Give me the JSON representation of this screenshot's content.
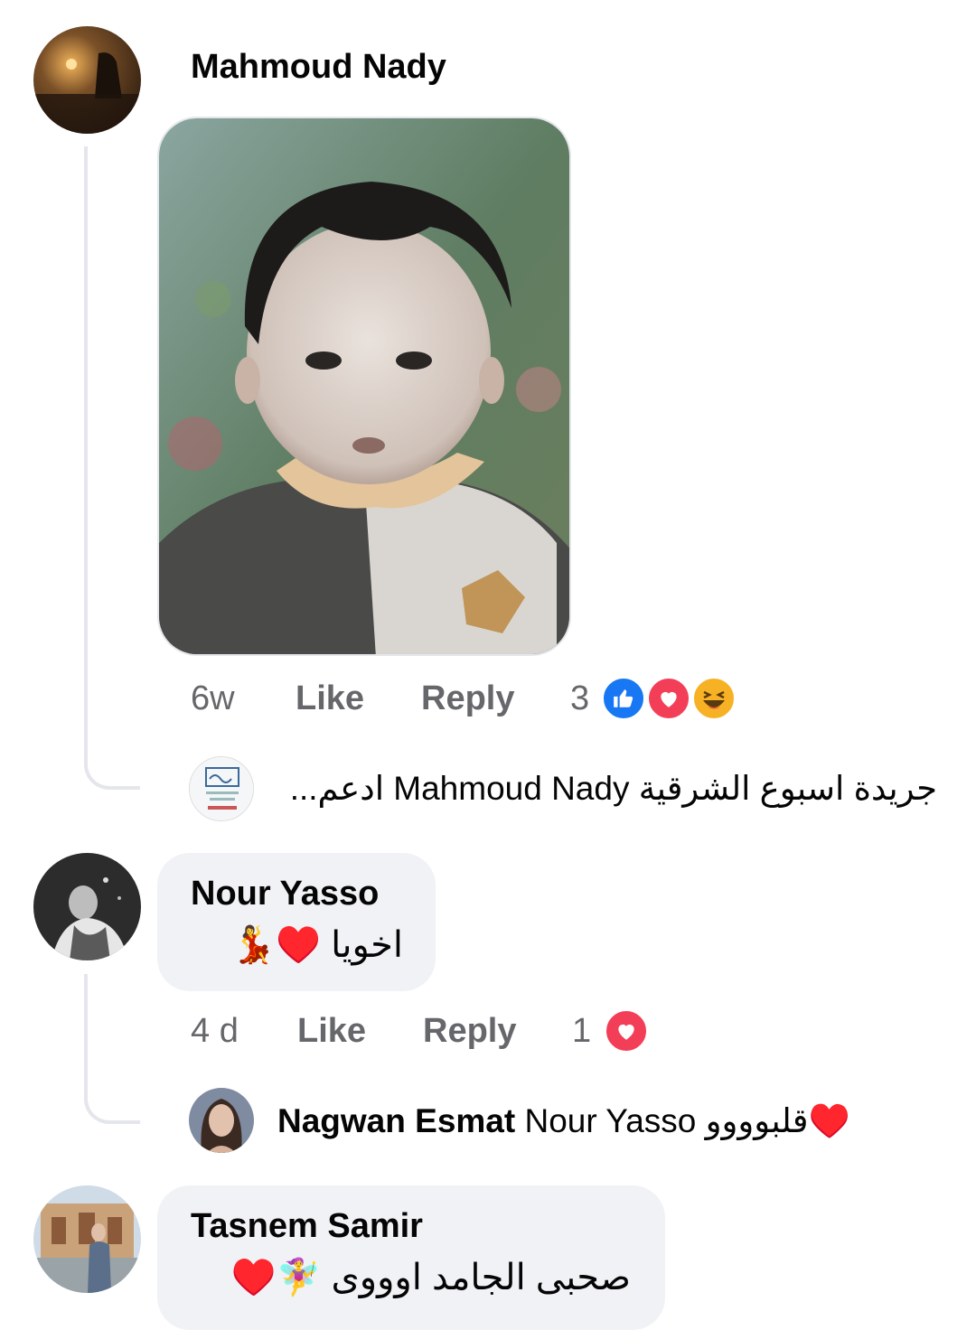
{
  "comments": [
    {
      "author": "Mahmoud Nady",
      "actions": {
        "time": "6w",
        "like": "Like",
        "reply": "Reply"
      },
      "reaction_count": "3",
      "reactions": [
        "like-icon",
        "love-icon",
        "haha-icon"
      ],
      "reply_preview": {
        "text": "جريدة اسبوع الشرقية Mahmoud Nady ادعم..."
      }
    },
    {
      "author": "Nour Yasso",
      "text": "اخويا ♥️💃",
      "actions": {
        "time": "4 d",
        "like": "Like",
        "reply": "Reply"
      },
      "reaction_count": "1",
      "reactions": [
        "love-icon"
      ],
      "reply_preview": {
        "author": "Nagwan Esmat",
        "text": "Nour Yasso قلبوووو♥️"
      }
    },
    {
      "author": "Tasnem Samir",
      "text": "صحبى الجامد اوووى 🧚‍♀️♥️"
    }
  ],
  "colors": {
    "bubble": "#f0f2f5",
    "meta": "#65676b",
    "like": "#1877f2",
    "love": "#f33e58",
    "haha": "#f7b125"
  }
}
